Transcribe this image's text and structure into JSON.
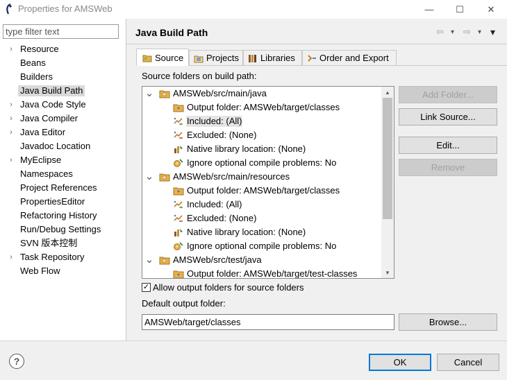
{
  "window": {
    "title": "Properties for AMSWeb",
    "min_glyph": "—",
    "max_glyph": "☐",
    "close_glyph": "✕"
  },
  "filter": {
    "placeholder": "type filter text",
    "value": ""
  },
  "nav": [
    {
      "label": "Resource",
      "arrow": "›",
      "selected": false
    },
    {
      "label": "Beans",
      "arrow": "",
      "selected": false
    },
    {
      "label": "Builders",
      "arrow": "",
      "selected": false
    },
    {
      "label": "Java Build Path",
      "arrow": "",
      "selected": true
    },
    {
      "label": "Java Code Style",
      "arrow": "›",
      "selected": false
    },
    {
      "label": "Java Compiler",
      "arrow": "›",
      "selected": false
    },
    {
      "label": "Java Editor",
      "arrow": "›",
      "selected": false
    },
    {
      "label": "Javadoc Location",
      "arrow": "",
      "selected": false
    },
    {
      "label": "MyEclipse",
      "arrow": "›",
      "selected": false
    },
    {
      "label": "Namespaces",
      "arrow": "",
      "selected": false
    },
    {
      "label": "Project References",
      "arrow": "",
      "selected": false
    },
    {
      "label": "PropertiesEditor",
      "arrow": "",
      "selected": false
    },
    {
      "label": "Refactoring History",
      "arrow": "",
      "selected": false
    },
    {
      "label": "Run/Debug Settings",
      "arrow": "",
      "selected": false
    },
    {
      "label": "SVN 版本控制",
      "arrow": "",
      "selected": false
    },
    {
      "label": "Task Repository",
      "arrow": "›",
      "selected": false
    },
    {
      "label": "Web Flow",
      "arrow": "",
      "selected": false
    }
  ],
  "page": {
    "title": "Java Build Path",
    "back_glyph": "⇦",
    "forward_glyph": "⇨",
    "dropdown_glyph": "▾"
  },
  "tabs": [
    {
      "label": "Source",
      "icon": "source-folder-icon",
      "active": true
    },
    {
      "label": "Projects",
      "icon": "projects-icon",
      "active": false
    },
    {
      "label": "Libraries",
      "icon": "libraries-icon",
      "active": false
    },
    {
      "label": "Order and Export",
      "icon": "order-export-icon",
      "active": false
    }
  ],
  "source": {
    "label": "Source folders on build path:",
    "tree": [
      {
        "label": "AMSWeb/src/main/java",
        "level": 0,
        "expanded": true,
        "icon": "package-folder-icon"
      },
      {
        "label": "Output folder: AMSWeb/target/classes",
        "level": 1,
        "icon": "output-folder-icon"
      },
      {
        "label": "Included: (All)",
        "level": 1,
        "icon": "inclusion-filter-icon",
        "highlight": true
      },
      {
        "label": "Excluded: (None)",
        "level": 1,
        "icon": "exclusion-filter-icon"
      },
      {
        "label": "Native library location: (None)",
        "level": 1,
        "icon": "native-library-icon"
      },
      {
        "label": "Ignore optional compile problems: No",
        "level": 1,
        "icon": "ignore-problems-icon"
      },
      {
        "label": "AMSWeb/src/main/resources",
        "level": 0,
        "expanded": true,
        "icon": "package-folder-icon"
      },
      {
        "label": "Output folder: AMSWeb/target/classes",
        "level": 1,
        "icon": "output-folder-icon"
      },
      {
        "label": "Included: (All)",
        "level": 1,
        "icon": "inclusion-filter-icon"
      },
      {
        "label": "Excluded: (None)",
        "level": 1,
        "icon": "exclusion-filter-icon"
      },
      {
        "label": "Native library location: (None)",
        "level": 1,
        "icon": "native-library-icon"
      },
      {
        "label": "Ignore optional compile problems: No",
        "level": 1,
        "icon": "ignore-problems-icon"
      },
      {
        "label": "AMSWeb/src/test/java",
        "level": 0,
        "expanded": true,
        "icon": "package-folder-icon"
      },
      {
        "label": "Output folder: AMSWeb/target/test-classes",
        "level": 1,
        "icon": "output-folder-icon"
      }
    ],
    "buttons": {
      "add_folder": "Add Folder...",
      "link_source": "Link Source...",
      "edit": "Edit...",
      "remove": "Remove"
    },
    "allow_output_label": "Allow output folders for source folders",
    "allow_output_checked": true,
    "check_glyph": "✓",
    "default_output_label": "Default output folder:",
    "default_output_value": "AMSWeb/target/classes",
    "browse": "Browse..."
  },
  "footer": {
    "help_glyph": "?",
    "ok": "OK",
    "cancel": "Cancel"
  },
  "colors": {
    "selection": "#d9d9d9",
    "focus_border": "#0078d7",
    "folder": "#e8b04a",
    "panel": "#f0f0f0"
  }
}
